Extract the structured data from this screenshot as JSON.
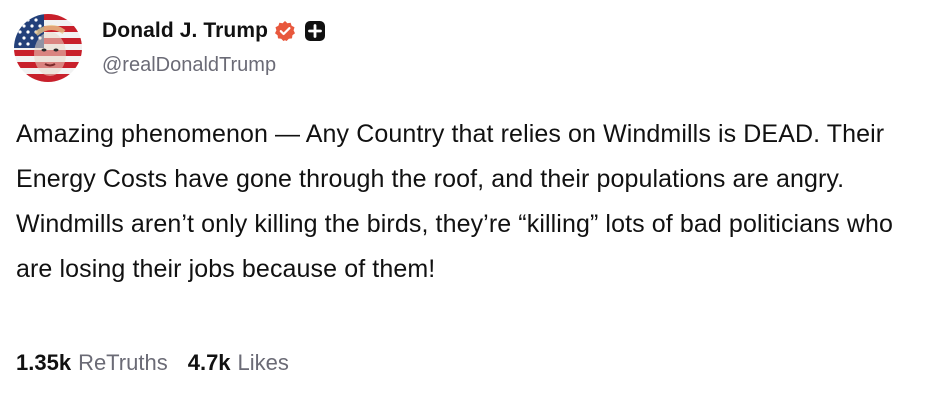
{
  "author": {
    "display_name": "Donald J. Trump",
    "handle": "@realDonaldTrump",
    "avatar_icon": "flag-face-avatar",
    "verified_icon": "verified-badge-icon",
    "plus_icon": "plus-square-icon",
    "verified_color": "#e8583d"
  },
  "post": {
    "text": "Amazing phenomenon — Any Country that relies on Windmills is DEAD. Their Energy Costs have gone through the roof, and their populations are angry. Windmills aren’t only killing the birds, they’re “killing” lots of bad politicians who are losing their jobs because of them!"
  },
  "stats": {
    "retruths_count": "1.35k",
    "retruths_label": "ReTruths",
    "likes_count": "4.7k",
    "likes_label": "Likes"
  }
}
